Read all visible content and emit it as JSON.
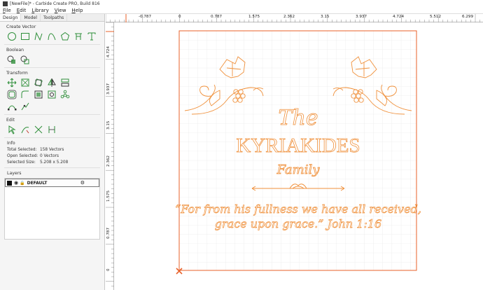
{
  "window": {
    "title": "[NewFile]* - Carbide Create PRO, Build 816"
  },
  "menu": [
    "File",
    "Edit",
    "Library",
    "View",
    "Help"
  ],
  "tabs": [
    {
      "label": "Design",
      "active": true
    },
    {
      "label": "Model",
      "active": false
    },
    {
      "label": "Toolpaths",
      "active": false
    }
  ],
  "sections": {
    "create_vector": "Create Vector",
    "boolean": "Boolean",
    "transform": "Transform",
    "edit": "Edit",
    "info": "Info",
    "layers": "Layers"
  },
  "create_vector_tools": [
    "circle-tool-icon",
    "rectangle-tool-icon",
    "polyline-tool-icon",
    "curve-tool-icon",
    "polygon-tool-icon",
    "star-tool-icon",
    "text-tool-icon"
  ],
  "boolean_tools": [
    "union-icon",
    "subtract-icon",
    "intersect-icon"
  ],
  "transform_tools_row1": [
    "move-icon",
    "scale-icon",
    "rotate-icon",
    "flip-icon",
    "align-icon"
  ],
  "transform_tools_row2": [
    "offset-icon",
    "fillet-icon",
    "group-icon",
    "ungroup-icon",
    "array-icon"
  ],
  "transform_tools_row3": [
    "node-edit-icon",
    "join-icon"
  ],
  "edit_tools": [
    "pick-icon",
    "trim-icon",
    "cut-icon",
    "delete-icon"
  ],
  "info": {
    "total_selected_label": "Total Selected:",
    "total_selected_value": "158 Vectors",
    "open_selected_label": "Open Selected:",
    "open_selected_value": "0 Vectors",
    "selected_size_label": "Selected Size:",
    "selected_size_value": "5.208 x 5.208"
  },
  "layers": [
    {
      "name": "DEFAULT",
      "color": "#111111"
    }
  ],
  "ruler": {
    "top_labels": [
      "-0.787",
      "0",
      "0.787",
      "1.575",
      "2.362",
      "3.15",
      "3.937",
      "4.724",
      "5.512",
      "6.299"
    ],
    "left_labels": [
      "4.724",
      "3.937",
      "3.15",
      "2.362",
      "1.575",
      "0.787",
      "0"
    ]
  },
  "design": {
    "line1": "The",
    "line2": "KYRIAKIDES",
    "line3": "Family",
    "quote_line1": "“For from his fullness we have all received,",
    "quote_line2": "grace upon grace.” John 1:16"
  },
  "colors": {
    "accent": "#e8612a",
    "vector": "#f0913c",
    "grid": "#e4e4e4",
    "ui_green": "#2f8f3a"
  }
}
